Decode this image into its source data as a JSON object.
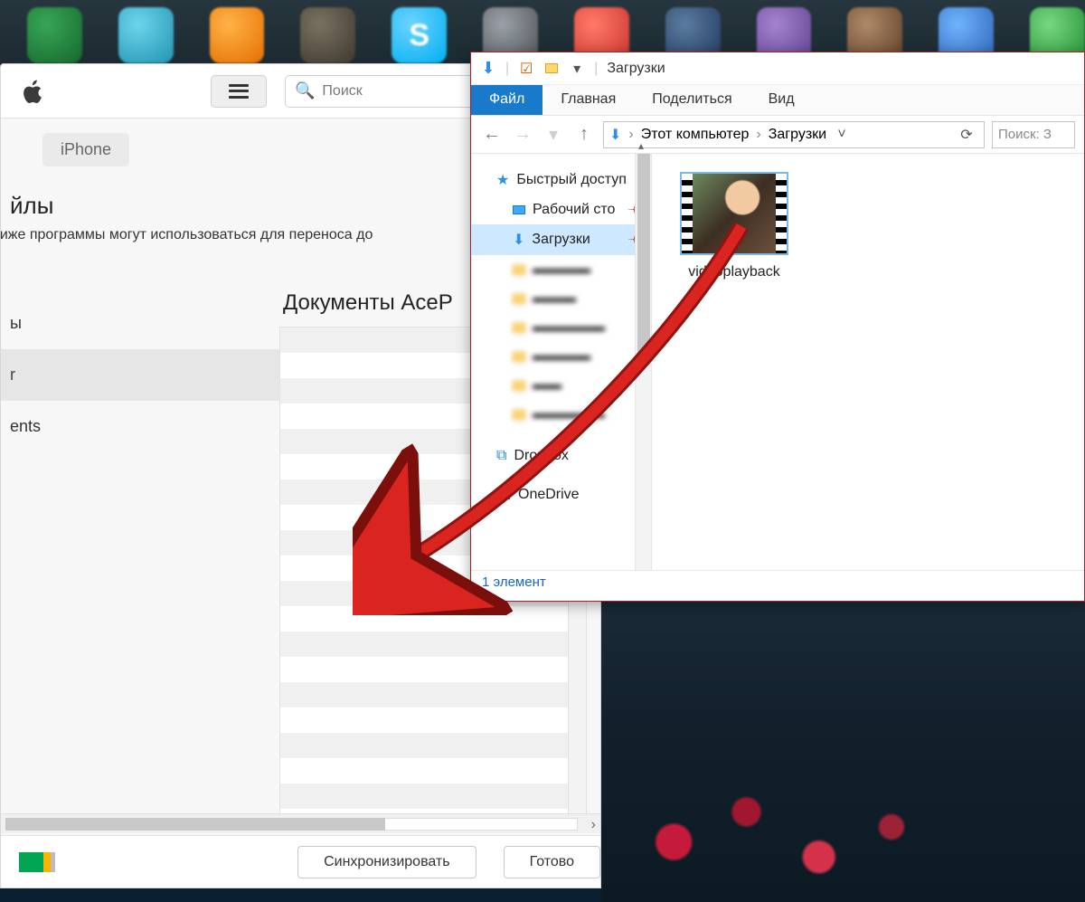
{
  "taskbar": {
    "icons": [
      "excel",
      "telegram",
      "browser",
      "gimp",
      "skype",
      "generic",
      "opera",
      "db",
      "p-purple",
      "brown",
      "blue2",
      "green2"
    ]
  },
  "itunes": {
    "search_placeholder": "Поиск",
    "device_tab": "iPhone",
    "heading_partial": "йлы",
    "subtext_partial": "ниже программы могут использоваться для переноса до",
    "sidebar": {
      "item_y": "ы",
      "item_r": "r",
      "item_ents": "ents"
    },
    "documents_title": "Документы AceP",
    "sync_button": "Синхронизировать",
    "done_button": "Готово"
  },
  "explorer": {
    "window_title": "Загрузки",
    "ribbon": {
      "file": "Файл",
      "home": "Главная",
      "share": "Поделиться",
      "view": "Вид"
    },
    "breadcrumb": {
      "root": "Этот компьютер",
      "current": "Загрузки"
    },
    "search_placeholder": "Поиск: З",
    "tree": {
      "quick_access": "Быстрый доступ",
      "desktop": "Рабочий сто",
      "downloads": "Загрузки",
      "dropbox": "Dropbox",
      "onedrive": "OneDrive"
    },
    "file": {
      "name": "videoplayback"
    },
    "status": "1 элемент"
  }
}
